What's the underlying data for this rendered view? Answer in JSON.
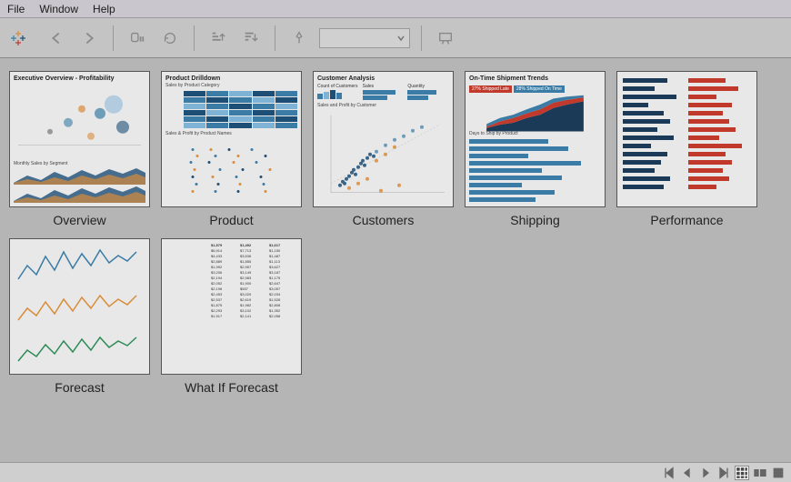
{
  "menubar": {
    "file": "File",
    "window": "Window",
    "help": "Help"
  },
  "sheets": [
    {
      "label": "Overview",
      "title": "Executive Overview - Profitability"
    },
    {
      "label": "Product",
      "title": "Product Drilldown"
    },
    {
      "label": "Customers",
      "title": "Customer Analysis"
    },
    {
      "label": "Shipping",
      "title": "On-Time Shipment Trends"
    },
    {
      "label": "Performance",
      "title": ""
    },
    {
      "label": "Forecast",
      "title": ""
    },
    {
      "label": "What If Forecast",
      "title": ""
    }
  ],
  "shipping": {
    "late_pct": "27%",
    "late_label": "Shipped Late",
    "ontime_pct": "28%",
    "ontime_label": "Shipped On Time",
    "sub1": "Days to Ship by Product"
  },
  "product": {
    "sub1": "Sales by Product Category",
    "sub2": "Sales & Profit by Product Names"
  },
  "customers": {
    "sub1": "Count of Customers",
    "sub2": "Sales",
    "sub3": "Quantity",
    "sub4": "Sales and Profit by Customer"
  },
  "overview": {
    "sub1": "Monthly Sales by Segment"
  },
  "colors": {
    "blue": "#3a7ca5",
    "darkblue": "#1d4e75",
    "orange": "#d98c3a",
    "red": "#c0392b",
    "green": "#2e8b57",
    "navy": "#1b3a57"
  }
}
